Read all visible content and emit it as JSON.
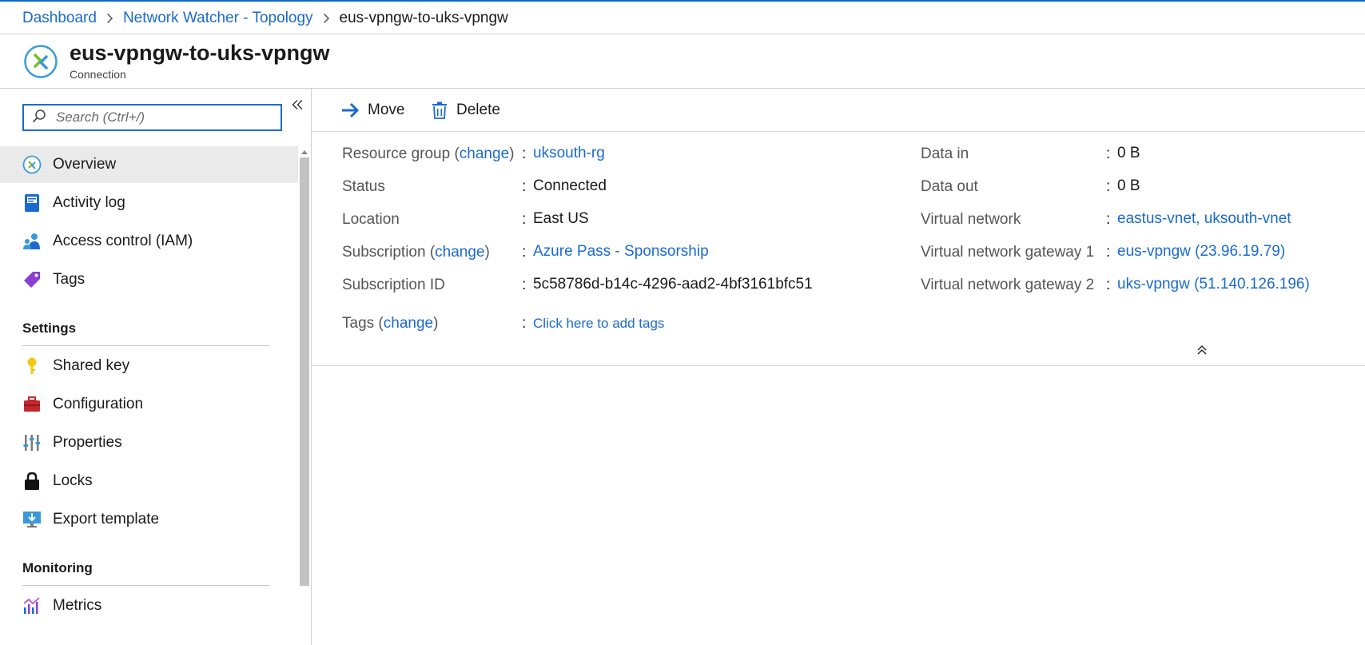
{
  "breadcrumb": {
    "items": [
      "Dashboard",
      "Network Watcher - Topology"
    ],
    "current": "eus-vpngw-to-uks-vpngw"
  },
  "header": {
    "title": "eus-vpngw-to-uks-vpngw",
    "subtitle": "Connection",
    "icon": "connection-icon"
  },
  "sidebar": {
    "search_placeholder": "Search (Ctrl+/)",
    "items": [
      {
        "label": "Overview",
        "icon": "overview-icon",
        "active": true
      },
      {
        "label": "Activity log",
        "icon": "activity-log-icon"
      },
      {
        "label": "Access control (IAM)",
        "icon": "iam-icon"
      },
      {
        "label": "Tags",
        "icon": "tag-icon"
      }
    ],
    "sections": [
      {
        "title": "Settings",
        "items": [
          {
            "label": "Shared key",
            "icon": "key-icon"
          },
          {
            "label": "Configuration",
            "icon": "toolbox-icon"
          },
          {
            "label": "Properties",
            "icon": "properties-icon"
          },
          {
            "label": "Locks",
            "icon": "lock-icon"
          },
          {
            "label": "Export template",
            "icon": "export-template-icon"
          }
        ]
      },
      {
        "title": "Monitoring",
        "items": [
          {
            "label": "Metrics",
            "icon": "metrics-icon"
          }
        ]
      }
    ]
  },
  "toolbar": {
    "move_label": "Move",
    "delete_label": "Delete"
  },
  "essentials": {
    "change_link": "change",
    "left": {
      "resource_group": {
        "label_prefix": "Resource group (",
        "label_suffix": ")",
        "value": "uksouth-rg"
      },
      "status": {
        "label": "Status",
        "value": "Connected"
      },
      "location": {
        "label": "Location",
        "value": "East US"
      },
      "subscription": {
        "label_prefix": "Subscription (",
        "label_suffix": ")",
        "value": "Azure Pass - Sponsorship"
      },
      "subscription_id": {
        "label": "Subscription ID",
        "value": "5c58786d-b14c-4296-aad2-4bf3161bfc51"
      },
      "tags": {
        "label_prefix": "Tags (",
        "label_suffix": ")",
        "value": "Click here to add tags"
      }
    },
    "right": {
      "data_in": {
        "label": "Data in",
        "value": "0 B"
      },
      "data_out": {
        "label": "Data out",
        "value": "0 B"
      },
      "virtual_network": {
        "label": "Virtual network",
        "value": "eastus-vnet, uksouth-vnet"
      },
      "gateway1": {
        "label": "Virtual network gateway 1",
        "value": "eus-vpngw (23.96.19.79)"
      },
      "gateway2": {
        "label": "Virtual network gateway 2",
        "value": "uks-vpngw (51.140.126.196)"
      }
    }
  },
  "colors": {
    "link": "#1a6ad1",
    "accent": "#0b6ad0",
    "active_bg": "#eaeaea"
  }
}
